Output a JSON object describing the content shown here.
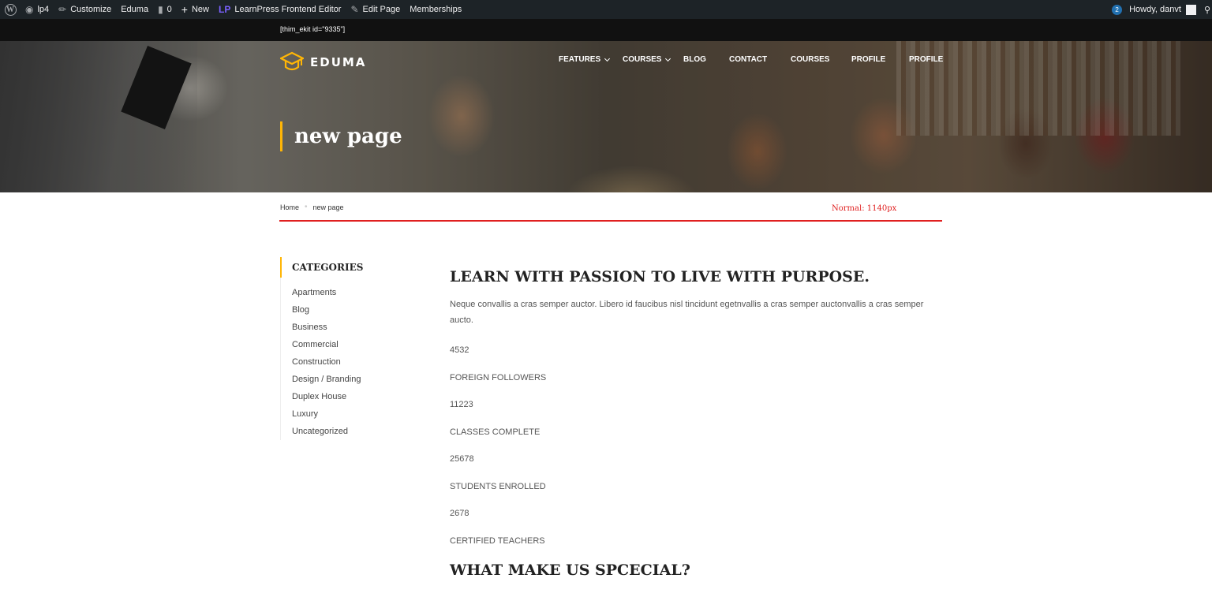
{
  "admin_bar": {
    "items": [
      {
        "label": "lp4",
        "icon": "dashboard-icon"
      },
      {
        "label": "Customize",
        "icon": "brush-icon"
      },
      {
        "label": "Eduma",
        "icon": ""
      },
      {
        "label": "0",
        "icon": "comment-icon"
      },
      {
        "label": "New",
        "icon": "plus-icon"
      },
      {
        "label": "LearnPress Frontend Editor",
        "icon": "learnpress-icon"
      },
      {
        "label": "Edit Page",
        "icon": "pencil-icon"
      },
      {
        "label": "Memberships",
        "icon": ""
      }
    ],
    "notifications": "2",
    "greeting": "Howdy, danvt",
    "bg_color": "#1d2327"
  },
  "shortcode": "[thim_ekit id=\"9335\"]",
  "header": {
    "logo_text": "EDUMA",
    "accent_color": "#ffb606",
    "nav": [
      {
        "label": "FEATURES",
        "dropdown": true
      },
      {
        "label": "COURSES",
        "dropdown": true
      },
      {
        "label": "BLOG",
        "dropdown": false
      },
      {
        "label": "CONTACT",
        "dropdown": false
      },
      {
        "label": "COURSES",
        "dropdown": false
      },
      {
        "label": "PROFILE",
        "dropdown": false
      },
      {
        "label": "PROFILE",
        "dropdown": false
      }
    ],
    "page_title": "new page"
  },
  "breadcrumb": {
    "home": "Home",
    "current": "new page"
  },
  "debug_label": "Normal: 1140px",
  "sidebar": {
    "title": "CATEGORIES",
    "items": [
      "Apartments",
      "Blog",
      "Business",
      "Commercial",
      "Construction",
      "Design / Branding",
      "Duplex House",
      "Luxury",
      "Uncategorized"
    ]
  },
  "content": {
    "heading": "LEARN WITH PASSION TO LIVE WITH PURPOSE.",
    "paragraph": "Neque convallis a cras semper auctor. Libero id faucibus nisl tincidunt egetnvallis a cras semper auctonvallis a cras semper aucto.",
    "stats": [
      {
        "value": "4532",
        "label": "FOREIGN FOLLOWERS"
      },
      {
        "value": "11223",
        "label": "CLASSES COMPLETE"
      },
      {
        "value": "25678",
        "label": "STUDENTS ENROLLED"
      },
      {
        "value": "2678",
        "label": "CERTIFIED TEACHERS"
      }
    ],
    "heading2": "WHAT MAKE US SPCECIAL?"
  }
}
